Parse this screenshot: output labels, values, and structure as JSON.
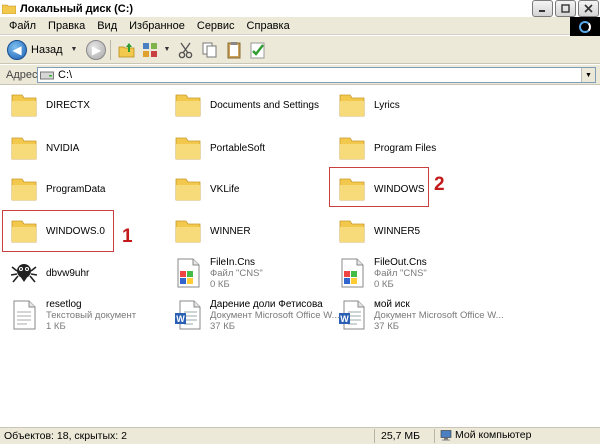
{
  "window": {
    "title": "Локальный диск (C:)"
  },
  "menu": [
    "Файл",
    "Правка",
    "Вид",
    "Избранное",
    "Сервис",
    "Справка"
  ],
  "toolbar": {
    "back_label": "Назад"
  },
  "address": {
    "label": "Адрес:",
    "value": "C:\\"
  },
  "items": [
    {
      "name": "DIRECTX",
      "type": "folder"
    },
    {
      "name": "Documents and Settings",
      "type": "folder"
    },
    {
      "name": "Lyrics",
      "type": "folder"
    },
    {
      "name": "NVIDIA",
      "type": "folder"
    },
    {
      "name": "PortableSoft",
      "type": "folder"
    },
    {
      "name": "Program Files",
      "type": "folder"
    },
    {
      "name": "ProgramData",
      "type": "folder"
    },
    {
      "name": "VKLife",
      "type": "folder"
    },
    {
      "name": "WINDOWS",
      "type": "folder"
    },
    {
      "name": "WINDOWS.0",
      "type": "folder"
    },
    {
      "name": "WINNER",
      "type": "folder"
    },
    {
      "name": "WINNER5",
      "type": "folder"
    },
    {
      "name": "dbvw9uhr",
      "type": "app"
    },
    {
      "name": "FileIn.Cns",
      "sub1": "Файл \"CNS\"",
      "sub2": "0 КБ",
      "type": "cns"
    },
    {
      "name": "FileOut.Cns",
      "sub1": "Файл \"CNS\"",
      "sub2": "0 КБ",
      "type": "cns"
    },
    {
      "name": "resetlog",
      "sub1": "Текстовый документ",
      "sub2": "1 КБ",
      "type": "txt"
    },
    {
      "name": "Дарение доли Фетисова",
      "sub1": "Документ Microsoft Office W...",
      "sub2": "37 КБ",
      "type": "word"
    },
    {
      "name": "мой иск",
      "sub1": "Документ Microsoft Office W...",
      "sub2": "37 КБ",
      "type": "word"
    }
  ],
  "annotations": {
    "marker1": "1",
    "marker2": "2"
  },
  "status": {
    "objects": "Объектов: 18, скрытых: 2",
    "size": "25,7 МБ",
    "location": "Мой компьютер"
  },
  "colors": {
    "folder": "#f2c94c",
    "annotation": "#c21a1a",
    "chrome": "#ece9d8"
  }
}
